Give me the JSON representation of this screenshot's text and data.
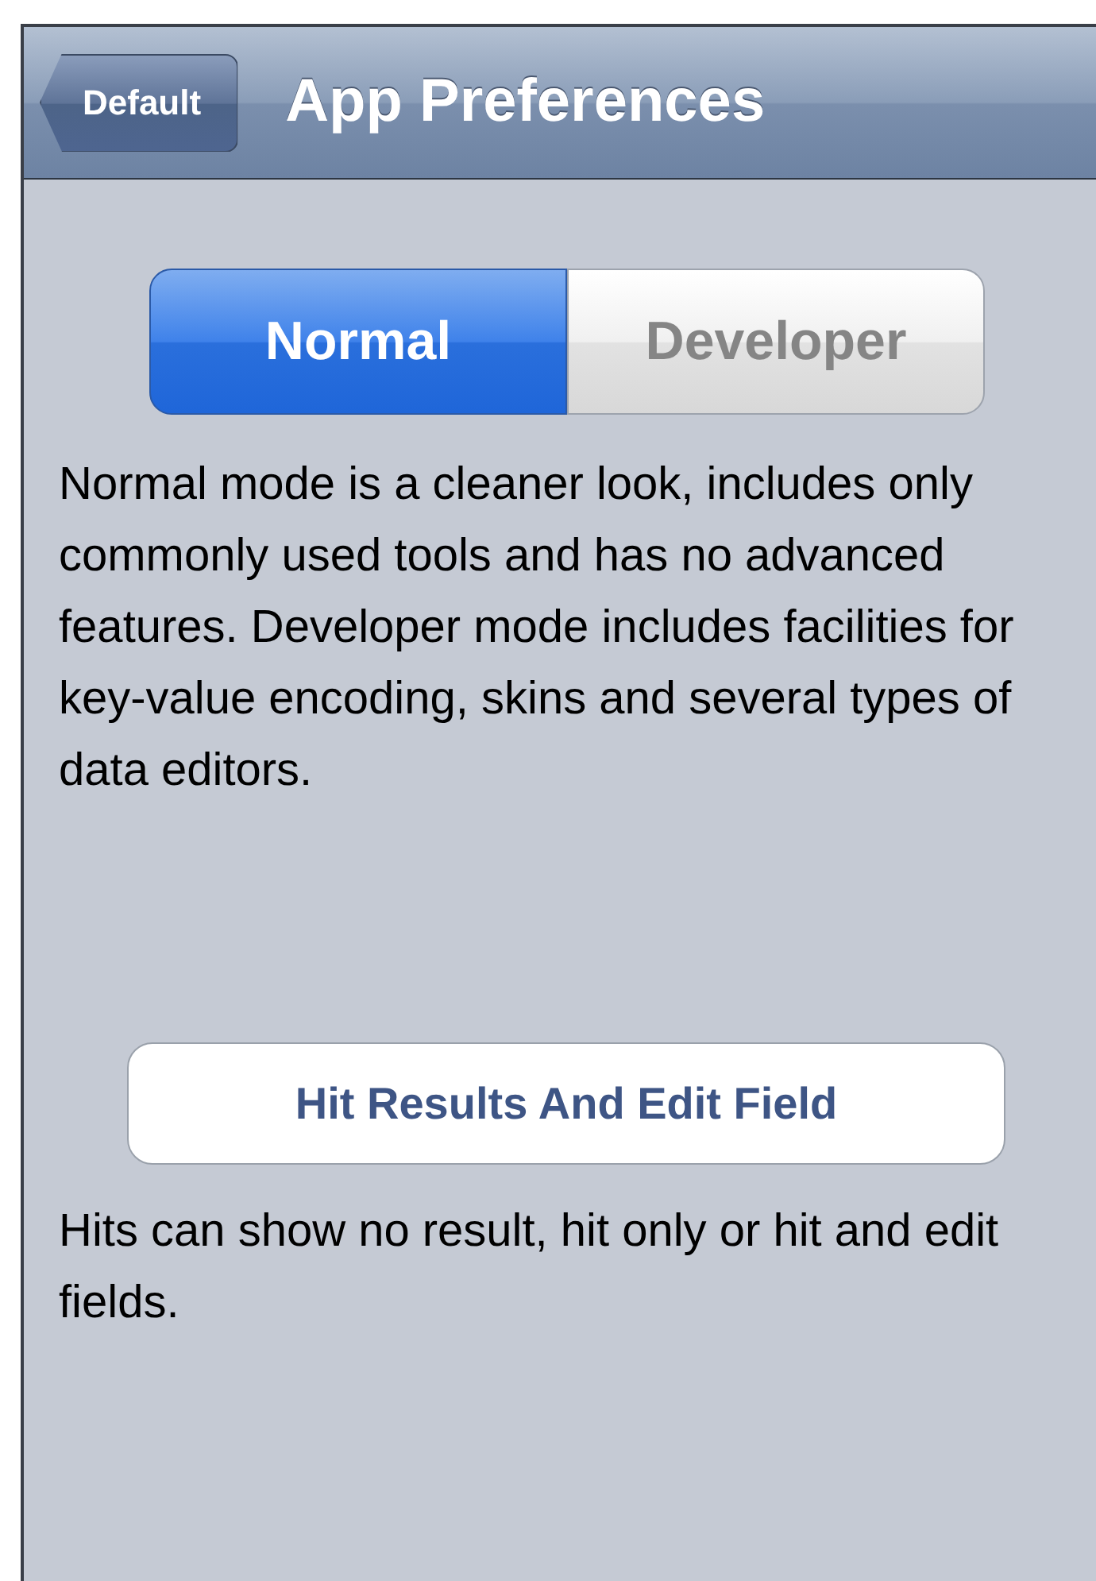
{
  "nav_bar": {
    "back_button": "Default",
    "title": "App Preferences"
  },
  "mode_control": {
    "segments": [
      {
        "label": "Normal",
        "selected": true
      },
      {
        "label": "Developer",
        "selected": false
      }
    ]
  },
  "mode_description": "Normal mode is a cleaner look, includes only commonly used tools and has no advanced features. Developer mode includes facilities for key-value encoding, skins and several types of data editors.",
  "hit_button": "Hit Results And Edit Field",
  "hit_description": "Hits can show no result, hit only or hit and edit fields."
}
